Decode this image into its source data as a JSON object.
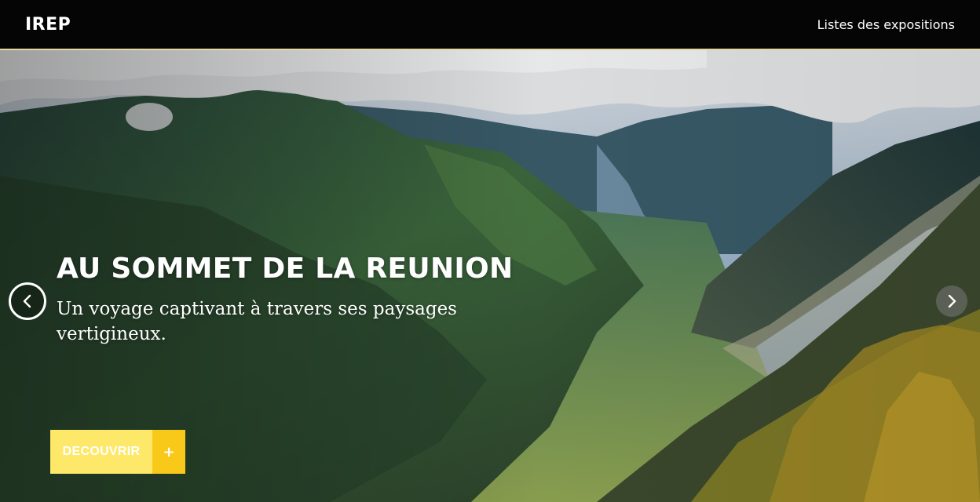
{
  "header": {
    "brand": "IREP",
    "nav_link": "Listes des expositions"
  },
  "hero": {
    "title": "AU SOMMET DE LA REUNION",
    "subtitle": "Un voyage captivant à travers ses paysages vertigineux.",
    "cta_label": "DECOUVRIR",
    "cta_plus": "+",
    "prev_icon": "chevron-left-icon",
    "next_icon": "chevron-right-icon"
  },
  "colors": {
    "topbar": "#050505",
    "topbar_border": "#e6d9a0",
    "cta_light": "#fde86a",
    "cta_dark": "#f9c919"
  }
}
